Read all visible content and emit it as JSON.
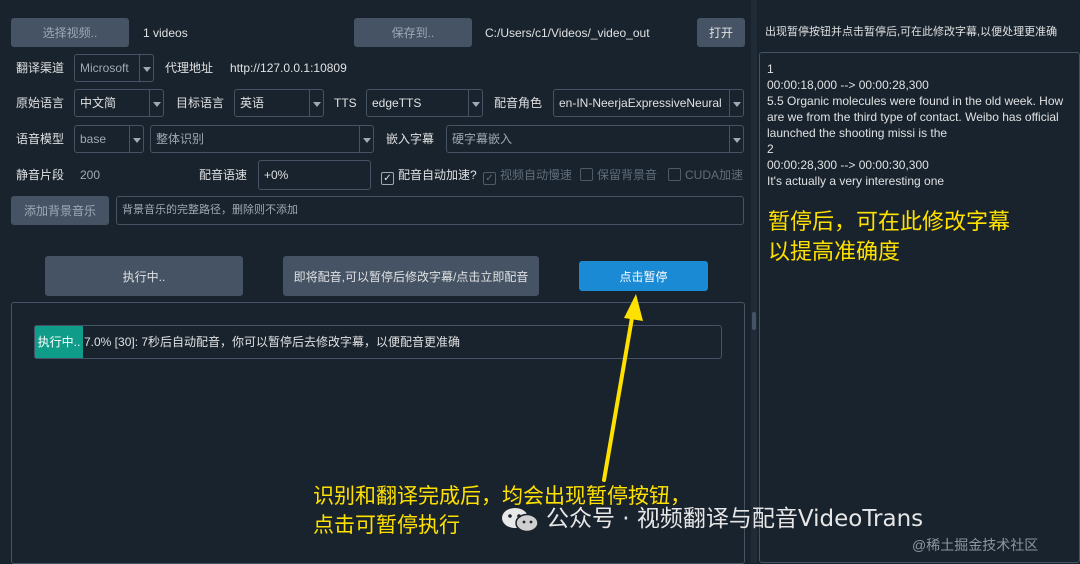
{
  "top": {
    "select_video_label": "选择视频..",
    "video_count": "1 videos",
    "save_to_label": "保存到..",
    "output_path": "C:/Users/c1/Videos/_video_out",
    "open_label": "打开"
  },
  "row1": {
    "channel_label": "翻译渠道",
    "channel_value": "Microsoft",
    "proxy_label": "代理地址",
    "proxy_value": "http://127.0.0.1:10809"
  },
  "row2": {
    "source_lang_label": "原始语言",
    "source_lang_value": "中文简",
    "target_lang_label": "目标语言",
    "target_lang_value": "英语",
    "tts_label": "TTS",
    "tts_value": "edgeTTS",
    "voice_label": "配音角色",
    "voice_value": "en-IN-NeerjaExpressiveNeural"
  },
  "row3": {
    "model_label": "语音模型",
    "model_value": "base",
    "recog_value": "整体识别",
    "embed_label": "嵌入字幕",
    "embed_value": "硬字幕嵌入"
  },
  "row4": {
    "silence_label": "静音片段",
    "silence_value": "200",
    "speed_label": "配音语速",
    "speed_value": "+0%",
    "auto_speed_label": "配音自动加速?",
    "video_slow_label": "视频自动慢速",
    "keep_bg_label": "保留背景音",
    "cuda_label": "CUDA加速"
  },
  "row5": {
    "add_bg_label": "添加背景音乐",
    "bg_placeholder": "背景音乐的完整路径，删除则不添加"
  },
  "actions": {
    "running_label": "执行中..",
    "dub_label": "即将配音,可以暂停后修改字幕/点击立即配音",
    "pause_label": "点击暂停"
  },
  "progress": {
    "badge": "执行中..",
    "text": "7.0%  [30]: 7秒后自动配音，你可以暂停后去修改字幕，以便配音更准确",
    "percent": 7.0
  },
  "right": {
    "header": "出现暂停按钮并点击暂停后,可在此修改字幕,以便处理更准确",
    "subtitle_lines": [
      "1",
      "00:00:18,000 --> 00:00:28,300",
      "5.5 Organic molecules were found in the old week. How",
      "are we from the third type of contact. Weibo has official",
      "launched the shooting missi is the",
      "2",
      "00:00:28,300 --> 00:00:30,300",
      "It's actually a very interesting one"
    ]
  },
  "annotations": {
    "right_line1": "暂停后，可在此修改字幕",
    "right_line2": "以提高准确度",
    "bottom_line1": "识别和翻译完成后，均会出现暂停按钮，",
    "bottom_line2": "点击可暂停执行",
    "watermark": "公众号 · 视频翻译与配音VideoTrans",
    "site": "@稀土掘金技术社区"
  },
  "colors": {
    "background": "#19232d",
    "button": "#455364",
    "accent_blue": "#1a8ad4",
    "badge_teal": "#0f9d8a",
    "annotation_yellow": "#ffe100"
  }
}
